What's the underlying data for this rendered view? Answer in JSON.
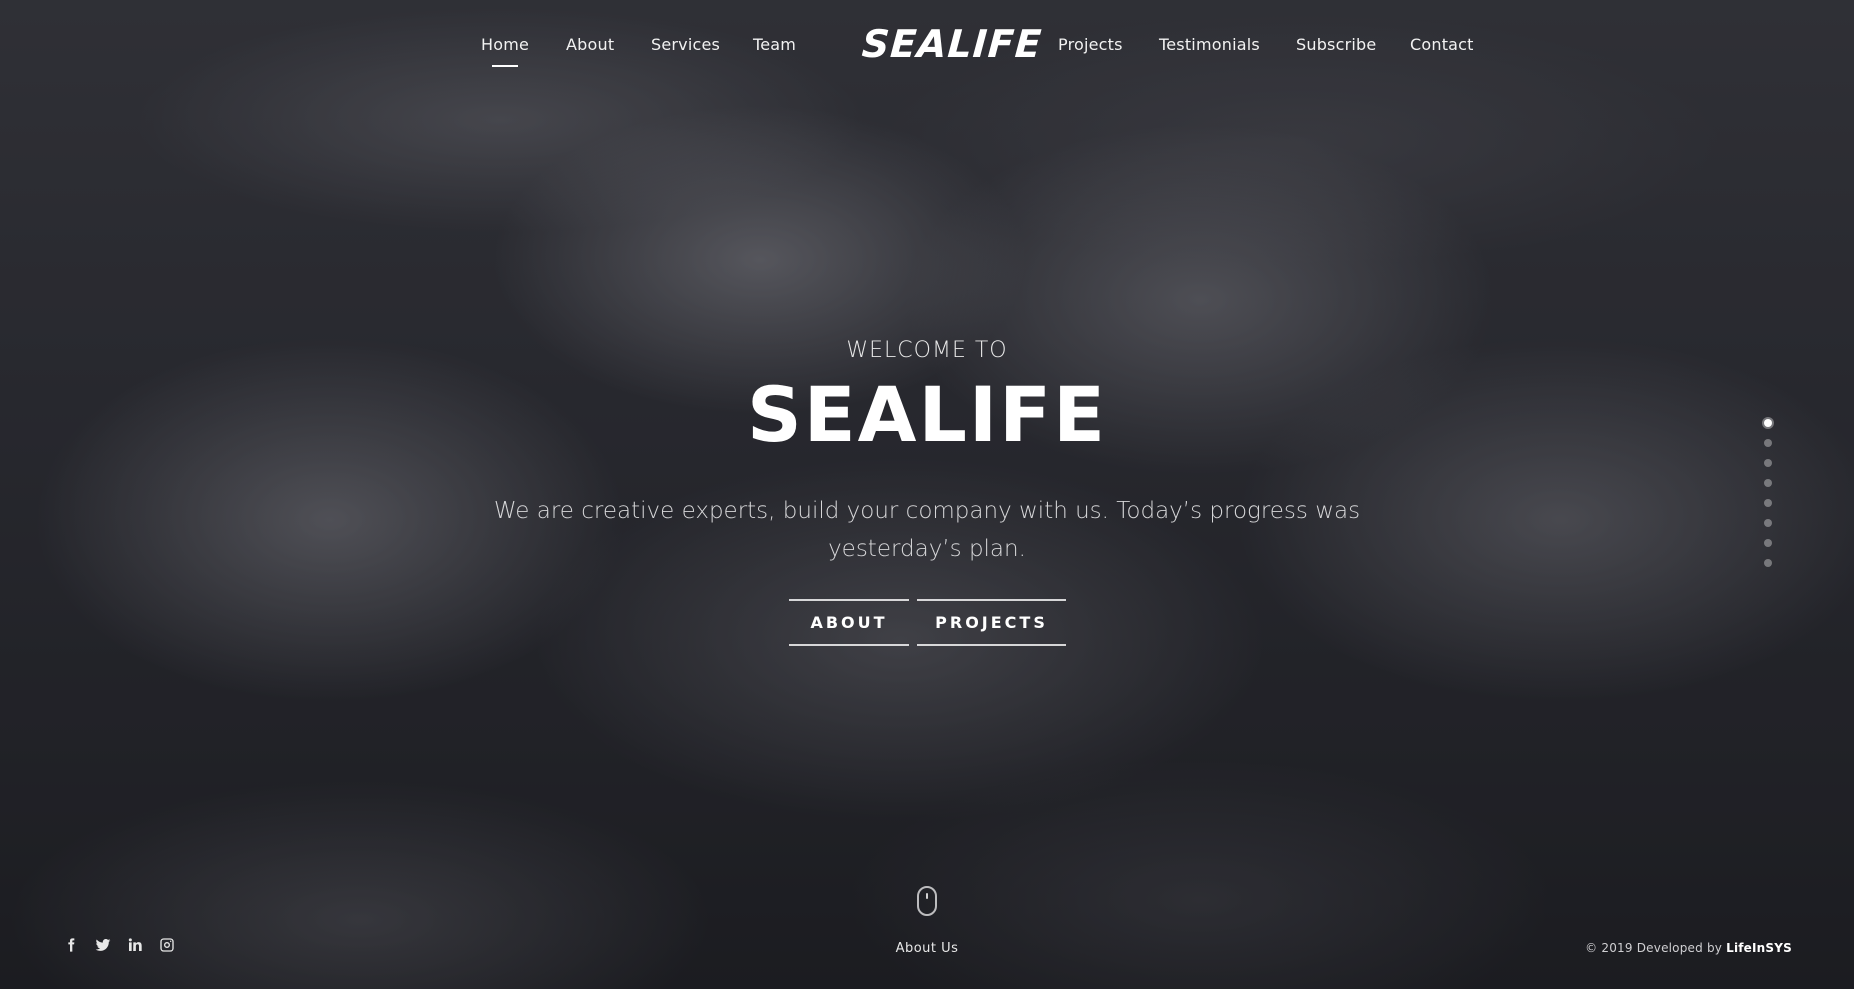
{
  "nav": {
    "left_links": [
      {
        "label": "Home",
        "active": true
      },
      {
        "label": "About"
      },
      {
        "label": "Services"
      },
      {
        "label": "Team"
      }
    ],
    "logo": "SEALIFE",
    "right_links": [
      {
        "label": "Projects"
      },
      {
        "label": "Testimonials"
      },
      {
        "label": "Subscribe"
      },
      {
        "label": "Contact"
      }
    ]
  },
  "hero": {
    "welcome": "WELCOME TO",
    "title": "SEALIFE",
    "text": "We are creative experts, build your company with us. Today’s progress was yesterday’s plan.",
    "buttons": {
      "about": "ABOUT",
      "projects": "PROJECTS"
    }
  },
  "section_dots": {
    "count": 8,
    "active_index": 0
  },
  "scroll": {
    "label": "About Us"
  },
  "socials": [
    "facebook-icon",
    "twitter-icon",
    "linkedin-icon",
    "instagram-icon"
  ],
  "footer": {
    "copyright_prefix": "© 2019 Developed by",
    "developer": "LifeInSYS"
  }
}
